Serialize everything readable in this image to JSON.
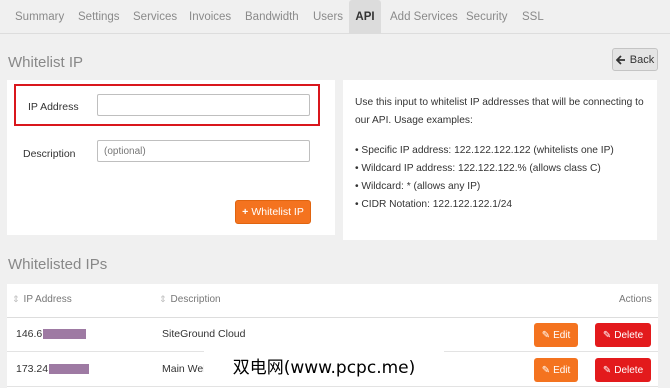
{
  "tabs": [
    {
      "label": "Summary",
      "active": false
    },
    {
      "label": "Settings",
      "active": false
    },
    {
      "label": "Services",
      "active": false
    },
    {
      "label": "Invoices",
      "active": false
    },
    {
      "label": "Bandwidth",
      "active": false
    },
    {
      "label": "Users",
      "active": false
    },
    {
      "label": "API",
      "active": true
    },
    {
      "label": "Add Services",
      "active": false
    },
    {
      "label": "Security",
      "active": false
    },
    {
      "label": "SSL",
      "active": false
    }
  ],
  "whitelist": {
    "title": "Whitelist IP",
    "back_label": "Back",
    "ip_label": "IP Address",
    "ip_value": "",
    "description_label": "Description",
    "description_placeholder": "(optional)",
    "submit_label": "Whitelist IP"
  },
  "info": {
    "intro": "Use this input to whitelist IP addresses that will be connecting to our API. Usage examples:",
    "examples": [
      "Specific IP address: 122.122.122.122 (whitelists one IP)",
      "Wildcard IP address: 122.122.122.% (allows class C)",
      "Wildcard: * (allows any IP)",
      "CIDR Notation: 122.122.122.1/24"
    ]
  },
  "list": {
    "title": "Whitelisted IPs",
    "columns": {
      "ip": "IP Address",
      "description": "Description",
      "actions": "Actions"
    },
    "rows": [
      {
        "ip": "146.6",
        "description": "SiteGround Cloud"
      },
      {
        "ip": "173.24",
        "description": "Main Webserver"
      }
    ],
    "edit_label": "Edit",
    "delete_label": "Delete"
  },
  "watermark": "双电网(www.pcpc.me)",
  "colors": {
    "accent_orange": "#f4731f",
    "danger_red": "#e31a1c",
    "highlight_red": "#d9161c"
  }
}
